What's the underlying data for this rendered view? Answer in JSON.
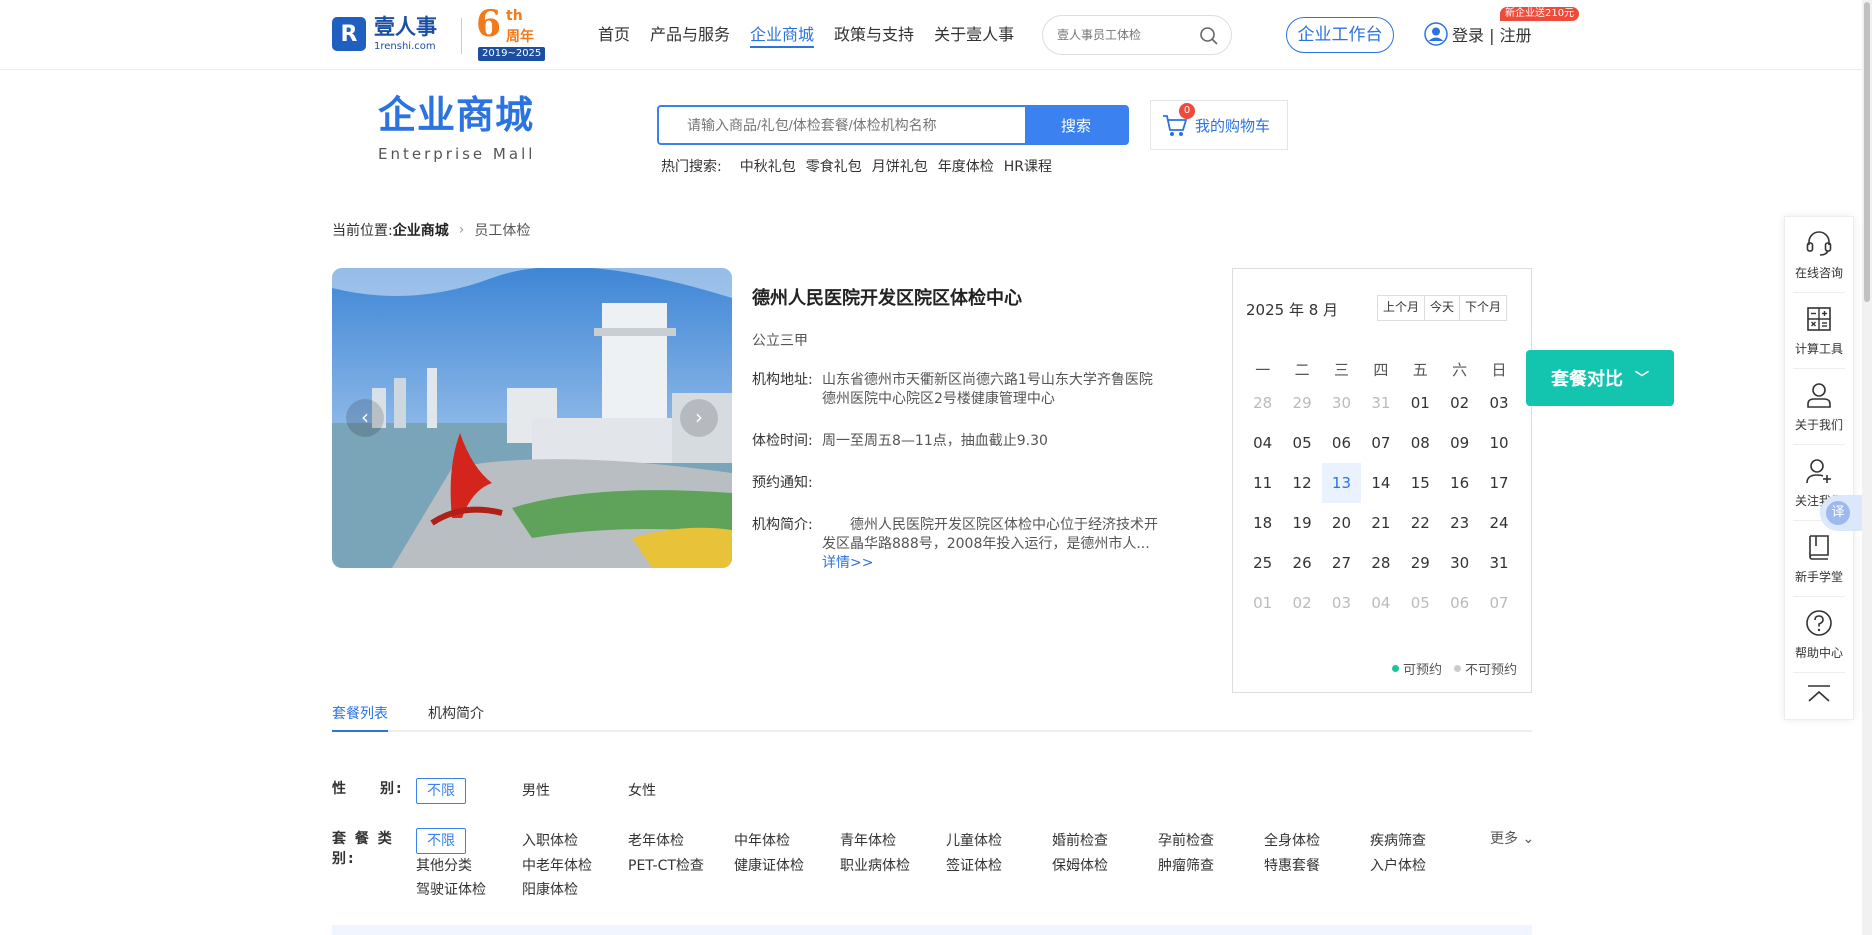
{
  "brand": {
    "logo_mark": "R",
    "name_cn": "壹人事",
    "name_en": "1renshi.com",
    "anniversary_num": "6",
    "anniversary_th": "th",
    "anniversary_cn": "周年",
    "anniversary_years": "2019~2025"
  },
  "nav": {
    "items": [
      {
        "label": "首页",
        "active": false
      },
      {
        "label": "产品与服务",
        "active": false
      },
      {
        "label": "企业商城",
        "active": true
      },
      {
        "label": "政策与支持",
        "active": false
      },
      {
        "label": "关于壹人事",
        "active": false
      }
    ],
    "search_placeholder": "壹人事员工体检",
    "workbench_label": "企业工作台",
    "login_label": "登录 | 注册",
    "promo_badge": "新企业送210元"
  },
  "mall": {
    "title": "企业商城",
    "subtitle": "Enterprise  Mall",
    "search_placeholder": "请输入商品/礼包/体检套餐/体检机构名称",
    "search_button": "搜索",
    "hot_label": "热门搜索:",
    "hot_items": [
      "中秋礼包",
      "零食礼包",
      "月饼礼包",
      "年度体检",
      "HR课程"
    ],
    "cart_count": "0",
    "cart_label": "我的购物车"
  },
  "breadcrumb": {
    "prefix": "当前位置:",
    "current": "企业商城",
    "last": "员工体检"
  },
  "hospital": {
    "name": "德州人民医院开发区院区体检中心",
    "level": "公立三甲",
    "address_label": "机构地址:",
    "address": "山东省德州市天衢新区尚德六路1号山东大学齐鲁医院德州医院中心院区2号楼健康管理中心",
    "time_label": "体检时间:",
    "time": "周一至周五8—11点，抽血截止9.30",
    "notice_label": "预约通知:",
    "notice": "",
    "intro_label": "机构简介:",
    "intro": "　　德州人民医院开发区院区体检中心位于经济技术开发区晶华路888号，2008年投入运行，是德州市人...",
    "more_link": "详情>>"
  },
  "calendar": {
    "title": "2025 年 8 月",
    "prev_label": "上个月",
    "today_label": "今天",
    "next_label": "下个月",
    "weekdays": [
      "一",
      "二",
      "三",
      "四",
      "五",
      "六",
      "日"
    ],
    "days": [
      {
        "d": "28",
        "muted": true
      },
      {
        "d": "29",
        "muted": true
      },
      {
        "d": "30",
        "muted": true
      },
      {
        "d": "31",
        "muted": true
      },
      {
        "d": "01"
      },
      {
        "d": "02"
      },
      {
        "d": "03"
      },
      {
        "d": "04"
      },
      {
        "d": "05"
      },
      {
        "d": "06"
      },
      {
        "d": "07"
      },
      {
        "d": "08"
      },
      {
        "d": "09"
      },
      {
        "d": "10"
      },
      {
        "d": "11"
      },
      {
        "d": "12"
      },
      {
        "d": "13",
        "today": true
      },
      {
        "d": "14"
      },
      {
        "d": "15"
      },
      {
        "d": "16"
      },
      {
        "d": "17"
      },
      {
        "d": "18"
      },
      {
        "d": "19"
      },
      {
        "d": "20"
      },
      {
        "d": "21"
      },
      {
        "d": "22"
      },
      {
        "d": "23"
      },
      {
        "d": "24"
      },
      {
        "d": "25"
      },
      {
        "d": "26"
      },
      {
        "d": "27"
      },
      {
        "d": "28"
      },
      {
        "d": "29"
      },
      {
        "d": "30"
      },
      {
        "d": "31"
      },
      {
        "d": "01",
        "muted": true
      },
      {
        "d": "02",
        "muted": true
      },
      {
        "d": "03",
        "muted": true
      },
      {
        "d": "04",
        "muted": true
      },
      {
        "d": "05",
        "muted": true
      },
      {
        "d": "06",
        "muted": true
      },
      {
        "d": "07",
        "muted": true
      }
    ],
    "legend_available": "可预约",
    "legend_unavailable": "不可预约"
  },
  "compare_label": "套餐对比",
  "tabs": [
    {
      "label": "套餐列表",
      "active": true
    },
    {
      "label": "机构简介",
      "active": false
    }
  ],
  "filters": {
    "gender_label": "性　　别:",
    "gender_options": [
      "不限",
      "男性",
      "女性"
    ],
    "category_label": "套 餐 类 别:",
    "category_options": [
      "不限",
      "入职体检",
      "老年体检",
      "中年体检",
      "青年体检",
      "儿童体检",
      "婚前检查",
      "孕前检查",
      "全身体检",
      "疾病筛查",
      "其他分类",
      "中老年体检",
      "PET-CT检查",
      "健康证体检",
      "职业病体检",
      "签证体检",
      "保姆体检",
      "肿瘤筛查",
      "特惠套餐",
      "入户体检",
      "驾驶证体检",
      "阳康体检"
    ],
    "more_label": "更多"
  },
  "side": {
    "items": [
      "在线咨询",
      "计算工具",
      "关于我们",
      "关注我们",
      "新手学堂",
      "帮助中心"
    ],
    "translate": "译"
  },
  "colors": {
    "primary": "#2b73e0",
    "search_blue": "#3b82f0",
    "compare_teal": "#13c4ae",
    "anniversary_orange": "#f27a1a",
    "badge_red": "#f04a3a"
  }
}
